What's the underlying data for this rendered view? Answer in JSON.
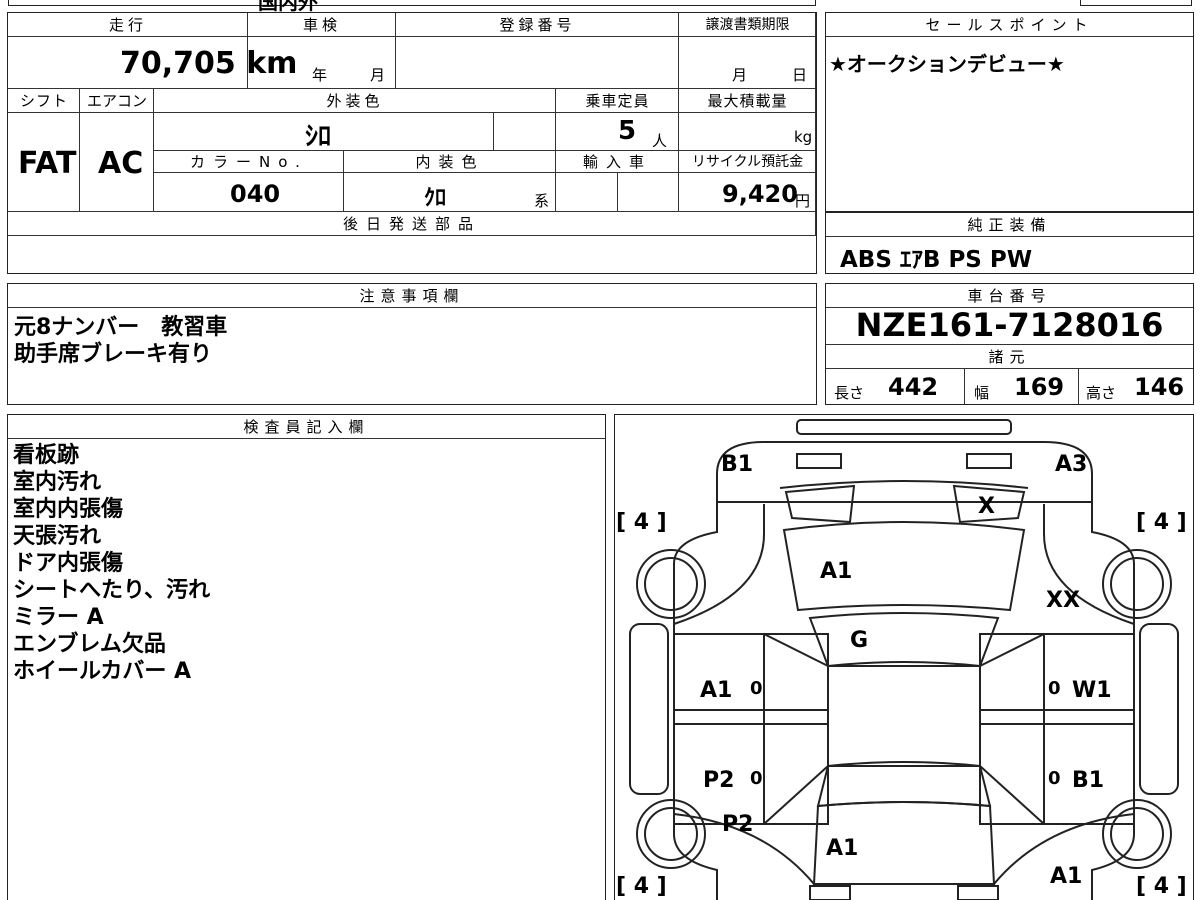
{
  "top_fragment": {
    "text": "国内外"
  },
  "vehicle_info": {
    "mileage": {
      "label": "走行",
      "value": "70,705",
      "unit": "km"
    },
    "inspection": {
      "label": "車検",
      "year_label": "年",
      "month_label": "月"
    },
    "registration_number": {
      "label": "登録番号",
      "value": ""
    },
    "transfer_deadline": {
      "label": "譲渡書類期限",
      "month_label": "月",
      "day_label": "日"
    },
    "shift": {
      "label": "シフト",
      "value": "FAT"
    },
    "air_conditioner": {
      "label": "エアコン",
      "value": "AC"
    },
    "exterior_color": {
      "label": "外装色",
      "value": "ｼﾛ"
    },
    "capacity": {
      "label": "乗車定員",
      "value": "5",
      "unit": "人"
    },
    "max_load": {
      "label": "最大積載量",
      "value": "",
      "unit": "kg"
    },
    "color_no": {
      "label": "カラーNo.",
      "value": "040"
    },
    "interior_color": {
      "label": "内装色",
      "value": "ｸﾛ",
      "suffix": "系"
    },
    "import_car": {
      "label": "輸入車",
      "value": ""
    },
    "recycle_fee": {
      "label": "リサイクル預託金",
      "value": "9,420",
      "unit": "円"
    },
    "later_parts": {
      "label": "後日発送部品",
      "value": ""
    }
  },
  "sales_point": {
    "label": "セールスポイント",
    "text": "★オークションデビュー★"
  },
  "standard_equipment": {
    "label": "純正装備",
    "text": "ABS ｴｱB PS PW"
  },
  "notes": {
    "label": "注意事項欄",
    "lines": [
      "元8ナンバー　教習車",
      "助手席ブレーキ有り"
    ]
  },
  "chassis": {
    "label": "車台番号",
    "value": "NZE161-7128016"
  },
  "specs": {
    "label": "諸元",
    "length_label": "長さ",
    "length": "442",
    "width_label": "幅",
    "width": "169",
    "height_label": "高さ",
    "height": "146"
  },
  "inspector": {
    "label": "検査員記入欄",
    "lines": [
      "看板跡",
      "室内汚れ",
      "室内内張傷",
      "天張汚れ",
      "ドア内張傷",
      "シートへたり、汚れ",
      "ミラー A",
      "エンブレム欠品",
      "ホイールカバー A"
    ]
  },
  "diagram": {
    "tire_fl": "[ 4 ]",
    "tire_fr": "[ 4 ]",
    "tire_rl": "[ 4 ]",
    "tire_rr": "[ 4 ]",
    "marks": {
      "front_left_corner": "B1",
      "front_right_corner": "A3",
      "windshield_right": "X",
      "hood": "A1",
      "front_right_fender": "XX",
      "windshield": "G",
      "front_left_door": "A1",
      "front_right_door": "W1",
      "rear_left_door": "P2",
      "rear_right_door": "B1",
      "rear_left_fender": "P2",
      "trunk": "A1",
      "rear_right_corner": "A1",
      "door_zero_1": "0",
      "door_zero_2": "0",
      "door_zero_3": "0",
      "door_zero_4": "0"
    }
  }
}
